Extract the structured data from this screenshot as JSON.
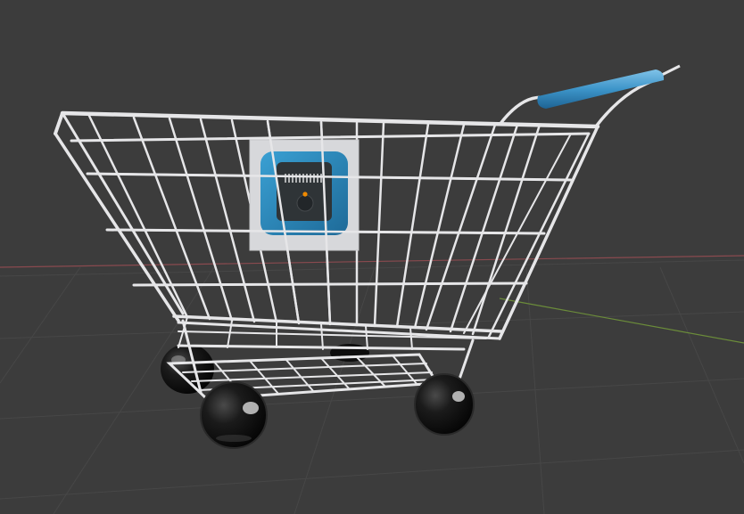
{
  "viewport": {
    "background_color": "#3c3c3c",
    "grid_color": "#474747",
    "x_axis_color": "#8a4a4f",
    "y_axis_color": "#6b8c3a"
  },
  "cart": {
    "frame_color": "#e6e6e8",
    "frame_shadow_color": "#b9babd",
    "handle_color": "#3d95c9",
    "wheel_color": "#111111",
    "wheel_highlight_color": "#d8d8d8",
    "sign_panel_color": "#d7d8db",
    "sign_badge_color": "#2a7fae",
    "sign_device_color": "#2f3437",
    "sign_led_color": "#f08a00"
  }
}
